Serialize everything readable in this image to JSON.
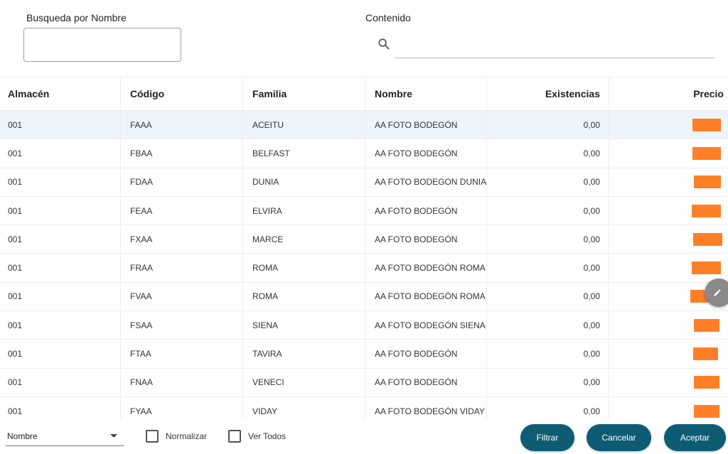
{
  "search": {
    "name_label": "Busqueda por Nombre",
    "name_value": "",
    "content_label": "Contenido",
    "content_value": ""
  },
  "table": {
    "columns": [
      "Almacén",
      "Código",
      "Familia",
      "Nombre",
      "Existencias",
      "Precio"
    ],
    "rows": [
      {
        "almacen": "001",
        "codigo": "FAAA",
        "familia": "ACEITU",
        "nombre": "AA FOTO BODEGÓN",
        "existencias": "0,00",
        "precio": "",
        "selected": true
      },
      {
        "almacen": "001",
        "codigo": "FBAA",
        "familia": "BELFAST",
        "nombre": "AA FOTO BODEGÓN",
        "existencias": "0,00",
        "precio": ""
      },
      {
        "almacen": "001",
        "codigo": "FDAA",
        "familia": "DUNIA",
        "nombre": "AA FOTO BODEGON DUNIA",
        "existencias": "0,00",
        "precio": ""
      },
      {
        "almacen": "001",
        "codigo": "FEAA",
        "familia": "ELVIRA",
        "nombre": "AA FOTO BODEGÓN",
        "existencias": "0,00",
        "precio": ""
      },
      {
        "almacen": "001",
        "codigo": "FXAA",
        "familia": "MARCE",
        "nombre": "AA FOTO BODEGÓN",
        "existencias": "0,00",
        "precio": ""
      },
      {
        "almacen": "001",
        "codigo": "FRAA",
        "familia": "ROMA",
        "nombre": "AA FOTO BODEGÓN ROMA",
        "existencias": "0,00",
        "precio": ""
      },
      {
        "almacen": "001",
        "codigo": "FVAA",
        "familia": "ROMA",
        "nombre": "AA FOTO BODEGÓN ROMA",
        "existencias": "0,00",
        "precio": ""
      },
      {
        "almacen": "001",
        "codigo": "FSAA",
        "familia": "SIENA",
        "nombre": "AA FOTO BODEGÓN SIENA",
        "existencias": "0,00",
        "precio": ""
      },
      {
        "almacen": "001",
        "codigo": "FTAA",
        "familia": "TAVIRA",
        "nombre": "AA FOTO BODEGÓN",
        "existencias": "0,00",
        "precio": ""
      },
      {
        "almacen": "001",
        "codigo": "FNAA",
        "familia": "VENECI",
        "nombre": "AA FOTO BODEGÓN",
        "existencias": "0,00",
        "precio": ""
      },
      {
        "almacen": "001",
        "codigo": "FYAA",
        "familia": "VIDAY",
        "nombre": "AA FOTO BODEGÓN VIDAY",
        "existencias": "0,00",
        "precio": ""
      }
    ]
  },
  "footer": {
    "sort_select_value": "Nombre",
    "normalizar_label": "Normalizar",
    "normalizar_checked": false,
    "ver_todos_label": "Ver Todos",
    "ver_todos_checked": false,
    "filtrar_label": "Filtrar",
    "cancelar_label": "Cancelar",
    "aceptar_label": "Aceptar"
  },
  "colors": {
    "button_bg": "#0d5c73",
    "redaction": "#ff7f27",
    "selected_row": "#eef4fb"
  }
}
